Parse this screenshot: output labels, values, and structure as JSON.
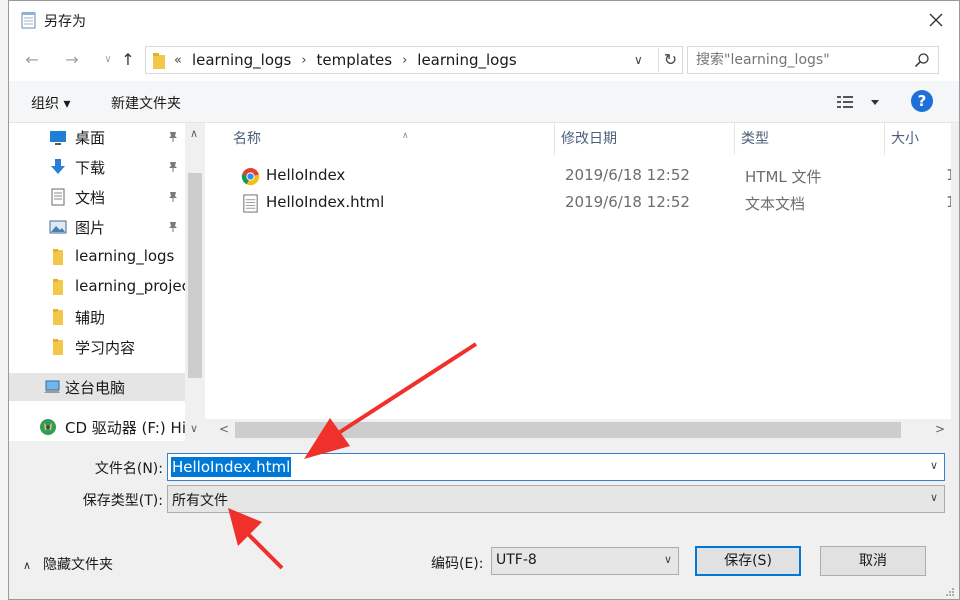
{
  "window": {
    "title": "另存为"
  },
  "address": {
    "overflow_glyph": "«",
    "breadcrumbs": [
      "learning_logs",
      "templates",
      "learning_logs"
    ],
    "separator": "›"
  },
  "search": {
    "placeholder": "搜索\"learning_logs\""
  },
  "toolbar": {
    "organize_label": "组织 ▾",
    "new_folder_label": "新建文件夹",
    "help_label": "?"
  },
  "nav": {
    "items": [
      {
        "label": "桌面",
        "icon": "desktop-icon",
        "pinned": true
      },
      {
        "label": "下载",
        "icon": "download-icon",
        "pinned": true
      },
      {
        "label": "文档",
        "icon": "documents-icon",
        "pinned": true
      },
      {
        "label": "图片",
        "icon": "pictures-icon",
        "pinned": true
      },
      {
        "label": "learning_logs",
        "icon": "folder-icon",
        "pinned": false
      },
      {
        "label": "learning_projec",
        "icon": "folder-icon",
        "pinned": false
      },
      {
        "label": "辅助",
        "icon": "folder-icon",
        "pinned": false
      },
      {
        "label": "学习内容",
        "icon": "folder-icon",
        "pinned": false
      }
    ],
    "this_pc": "这台电脑",
    "cd_drive": "CD 驱动器 (F:) HiS"
  },
  "columns": {
    "name": "名称",
    "date": "修改日期",
    "type": "类型",
    "size": "大小"
  },
  "files": [
    {
      "name": "HelloIndex",
      "date": "2019/6/18 12:52",
      "type": "HTML 文件",
      "size": "1",
      "icon": "chrome-icon"
    },
    {
      "name": "HelloIndex.html",
      "date": "2019/6/18 12:52",
      "type": "文本文档",
      "size": "1",
      "icon": "text-file-icon"
    }
  ],
  "form": {
    "filename_label": "文件名(N):",
    "filename_value": "HelloIndex.html",
    "filetype_label": "保存类型(T):",
    "filetype_value": "所有文件",
    "encoding_label": "编码(E):",
    "encoding_value": "UTF-8"
  },
  "footer": {
    "hide_folders": "隐藏文件夹",
    "save": "保存(S)",
    "cancel": "取消"
  },
  "colors": {
    "accent": "#0078d7",
    "annotation_arrow": "#f0302a",
    "help": "#1e6fd9"
  }
}
